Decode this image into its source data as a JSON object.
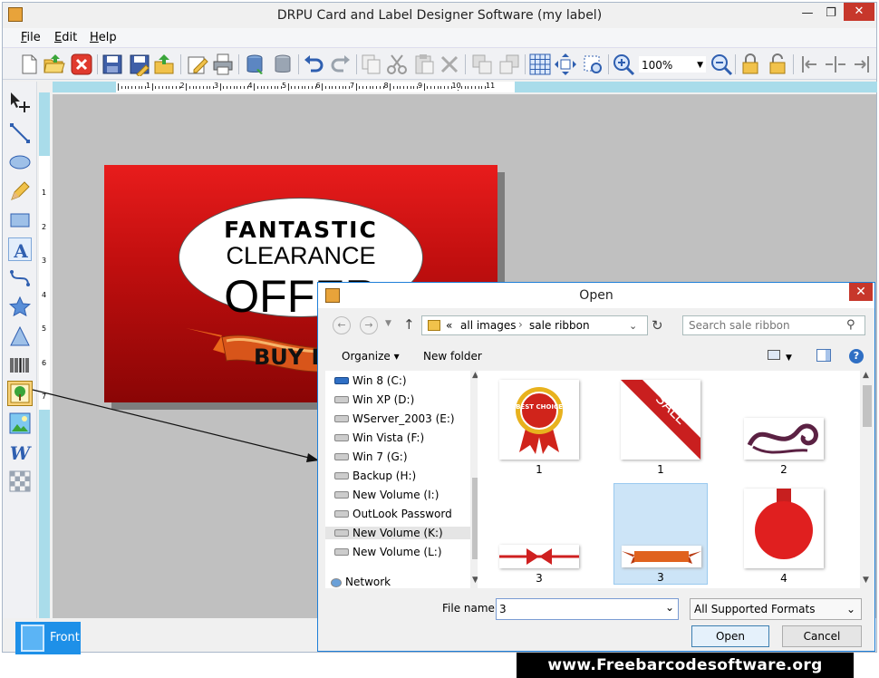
{
  "window": {
    "title": "DRPU Card and Label Designer Software  (my label)",
    "min_glyph": "—",
    "max_glyph": "❐",
    "close_glyph": "✕"
  },
  "menu": {
    "file": "File",
    "edit": "Edit",
    "help": "Help"
  },
  "toolbar": {
    "zoom_value": "100%"
  },
  "ruler": {
    "top_ticks": [
      "1",
      "2",
      "3",
      "4",
      "5",
      "6",
      "7",
      "8",
      "9",
      "10",
      "11"
    ],
    "left_ticks": [
      "1",
      "2",
      "3",
      "4",
      "5",
      "6",
      "7"
    ]
  },
  "label_design": {
    "line1": "FANTASTIC",
    "line2": "CLEARANCE",
    "line3": "OFFER",
    "ribbon_text": "BUY N"
  },
  "tabs": {
    "front": "Front"
  },
  "dialog": {
    "title": "Open",
    "close_glyph": "✕",
    "breadcrumb": {
      "prefix": "«",
      "crumb1": "all images",
      "crumb2": "sale ribbon"
    },
    "search_placeholder": "Search sale ribbon",
    "organize": "Organize ▾",
    "new_folder": "New folder",
    "nav_items": [
      "Win 8 (C:)",
      "Win XP (D:)",
      "WServer_2003 (E:)",
      "Win Vista (F:)",
      "Win 7 (G:)",
      "Backup (H:)",
      "New Volume (I:)",
      "OutLook Password",
      "New Volume (K:)",
      "New Volume (L:)",
      "Network"
    ],
    "files": [
      {
        "caption": "1",
        "badge_text": "BEST CHOICE"
      },
      {
        "caption": "1",
        "badge_text": "SALE"
      },
      {
        "caption": "2"
      },
      {
        "caption": "3"
      },
      {
        "caption": "3"
      },
      {
        "caption": "4"
      }
    ],
    "filename_label": "File name:",
    "filename_value": "3",
    "filetype": "All Supported Formats",
    "open_label": "Open",
    "cancel_label": "Cancel"
  },
  "banner": {
    "text": "www.Freebarcodesoftware.org"
  }
}
